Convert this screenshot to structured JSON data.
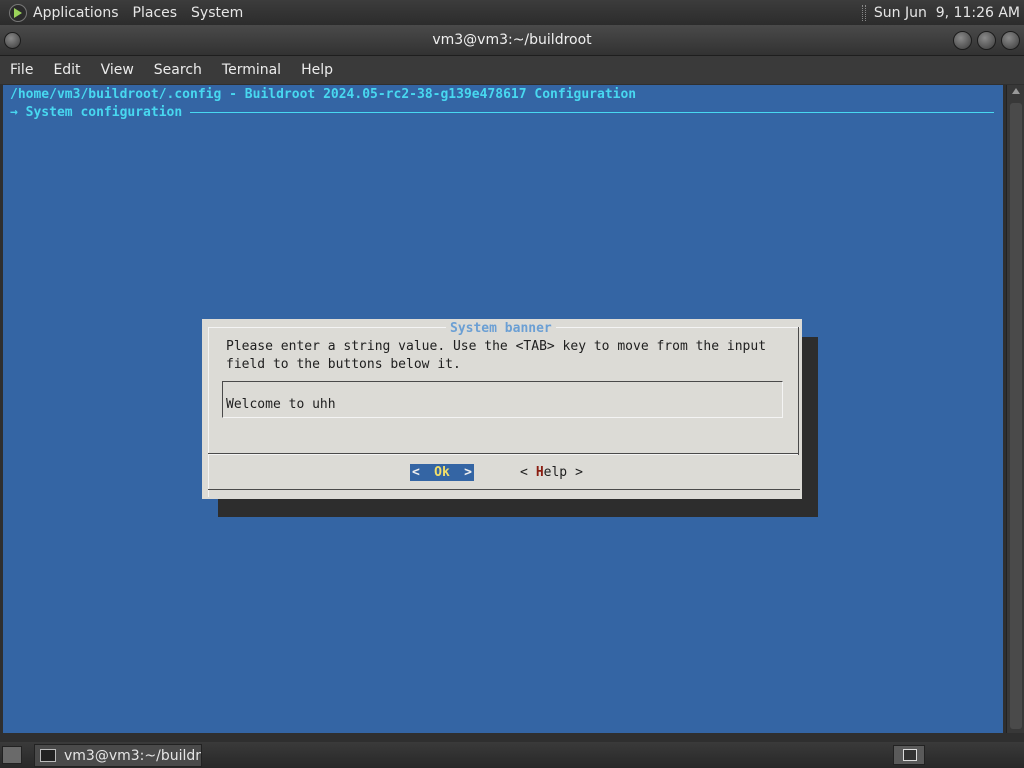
{
  "top_panel": {
    "menus": [
      "Applications",
      "Places",
      "System"
    ],
    "clock": "Sun Jun  9, 11:26 AM"
  },
  "window": {
    "title": "vm3@vm3:~/buildroot"
  },
  "menubar": {
    "items": [
      "File",
      "Edit",
      "View",
      "Search",
      "Terminal",
      "Help"
    ]
  },
  "terminal": {
    "path_line": "/home/vm3/buildroot/.config - Buildroot 2024.05-rc2-38-g139e478617 Configuration",
    "breadcrumb": "→ System configuration"
  },
  "dialog": {
    "title": "System banner",
    "prompt": "Please enter a string value. Use the <TAB> key to move from the input\nfield to the buttons below it.",
    "input_value": "Welcome to uhh",
    "ok_button": {
      "left": "<",
      "label": "Ok",
      "right": ">"
    },
    "help_button": {
      "left": "<",
      "hotkey": "H",
      "rest": "elp",
      "right": ">"
    }
  },
  "taskbar": {
    "task_label": "vm3@vm3:~/buildr..."
  },
  "colors": {
    "terminal_bg": "#3465a4",
    "terminal_text": "#48d8f0",
    "dialog_bg": "#dcdbd6",
    "dialog_title": "#6b9fd4"
  }
}
